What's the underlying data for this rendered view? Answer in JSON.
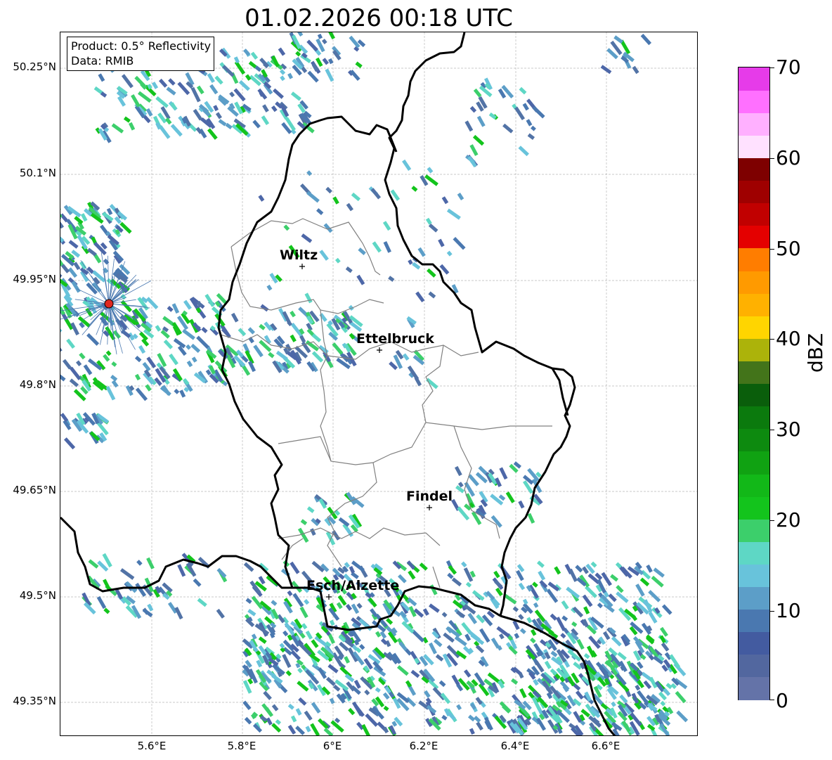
{
  "title": "01.02.2026 00:18 UTC",
  "infobox": {
    "product": "Product: 0.5° Reflectivity",
    "data": "Data: RMIB"
  },
  "axes": {
    "lat_labels": [
      "50.25°N",
      "50.1°N",
      "49.95°N",
      "49.8°N",
      "49.65°N",
      "49.5°N",
      "49.35°N"
    ],
    "lon_labels": [
      "5.6°E",
      "5.8°E",
      "6°E",
      "6.2°E",
      "6.4°E",
      "6.6°E"
    ]
  },
  "cities": [
    {
      "name": "Wiltz"
    },
    {
      "name": "Ettelbruck"
    },
    {
      "name": "Findel"
    },
    {
      "name": "Esch/Alzette"
    }
  ],
  "colorbar": {
    "label": "dBZ",
    "ticks": [
      "70",
      "60",
      "50",
      "40",
      "30",
      "20",
      "10",
      "0"
    ],
    "colors": [
      "#6473a8",
      "#52679f",
      "#435ba0",
      "#4a78b0",
      "#5c9ec8",
      "#68c3db",
      "#5ed7c5",
      "#3ccf6b",
      "#13c41c",
      "#12b818",
      "#10a212",
      "#0d8a0f",
      "#0b7a0d",
      "#0a5e0b",
      "#43741a",
      "#acb30a",
      "#ffd500",
      "#ffb100",
      "#ff9a00",
      "#ff7d00",
      "#e40000",
      "#c10000",
      "#9f0000",
      "#7e0000",
      "#ffe1ff",
      "#ffb0ff",
      "#ff70ff",
      "#e63be9"
    ]
  },
  "colors": {
    "border": "#000000",
    "cantons": "#808080",
    "radar_site": "#e0281f"
  }
}
